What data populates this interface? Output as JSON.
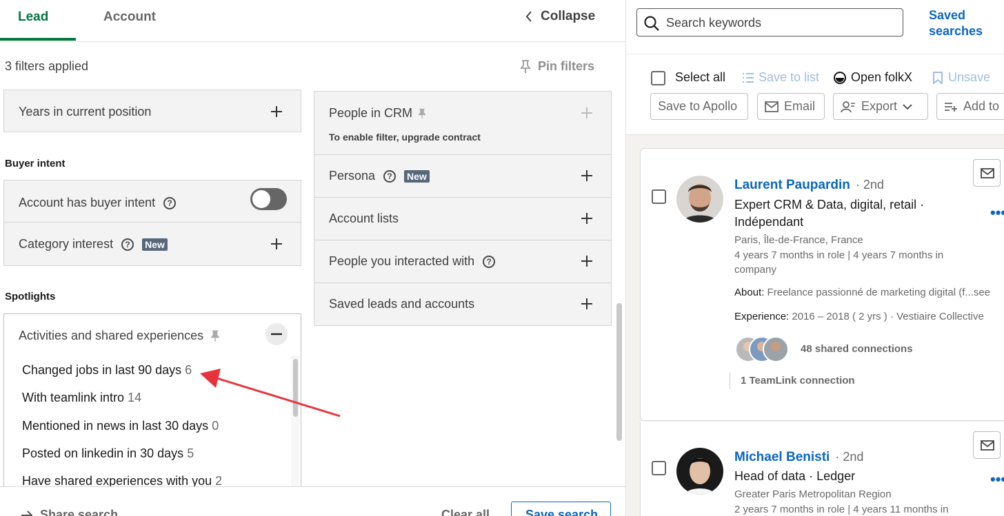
{
  "left_panel": {
    "tabs": [
      {
        "label": "Lead",
        "active": true
      },
      {
        "label": "Account",
        "active": false
      }
    ],
    "collapse_label": "Collapse",
    "filters_applied": "3 filters applied",
    "pin_filters_label": "Pin filters",
    "years_in_position": "Years in current position",
    "buyer_intent_title": "Buyer intent",
    "account_buyer_intent": "Account has buyer intent",
    "category_interest": "Category interest",
    "new_badge": "New",
    "spotlights_title": "Spotlights",
    "activities_label": "Activities and shared experiences",
    "spotlight_items": [
      {
        "label": "Changed jobs in last 90 days",
        "count": "6"
      },
      {
        "label": "With teamlink intro",
        "count": "14"
      },
      {
        "label": "Mentioned in news in last 30 days",
        "count": "0"
      },
      {
        "label": "Posted on linkedin in 30 days",
        "count": "5"
      },
      {
        "label": "Have shared experiences with you",
        "count": "2"
      }
    ],
    "people_in_crm": "People in CRM",
    "crm_upgrade_note": "To enable filter, upgrade contract",
    "persona": "Persona",
    "account_lists": "Account lists",
    "people_interacted": "People you interacted with",
    "saved_leads_accounts": "Saved leads and accounts",
    "footer": {
      "share_search": "Share search",
      "clear_all": "Clear all",
      "save_search": "Save search"
    }
  },
  "right_panel": {
    "search_placeholder": "Search keywords",
    "saved_searches": "Saved searches",
    "toolbar": {
      "select_all": "Select all",
      "save_to_list": "Save to list",
      "open_folkx": "Open folkX",
      "unsave": "Unsave",
      "save_to_apollo": "Save to Apollo",
      "email": "Email",
      "export": "Export",
      "add_to": "Add to"
    },
    "leads": [
      {
        "name": "Laurent Paupardin",
        "degree": "· 2nd",
        "title_line1": "Expert CRM & Data, digital, retail ·",
        "title_line2": "Indépendant",
        "location": "Paris, Île-de-France, France",
        "tenure_line1": "4 years 7 months in role | 4 years 7 months in",
        "tenure_line2": "company",
        "about_label": "About:",
        "about_text": "Freelance passionné de marketing digital (f...see",
        "experience_label": "Experience:",
        "experience_text": "2016 – 2018   ( 2 yrs ) · Vestiaire Collective",
        "shared_connections": "48 shared connections",
        "teamlink": "1 TeamLink connection"
      },
      {
        "name": "Michael Benisti",
        "degree": "· 2nd",
        "title_line1": "Head of data · Ledger",
        "location": "Greater Paris Metropolitan Region",
        "tenure_line1": "2 years 7 months in role | 4 years 11 months in"
      }
    ],
    "colors": {
      "link_blue": "#0a66c2",
      "active_green": "#057642",
      "annotation_red": "#e8323c"
    }
  }
}
